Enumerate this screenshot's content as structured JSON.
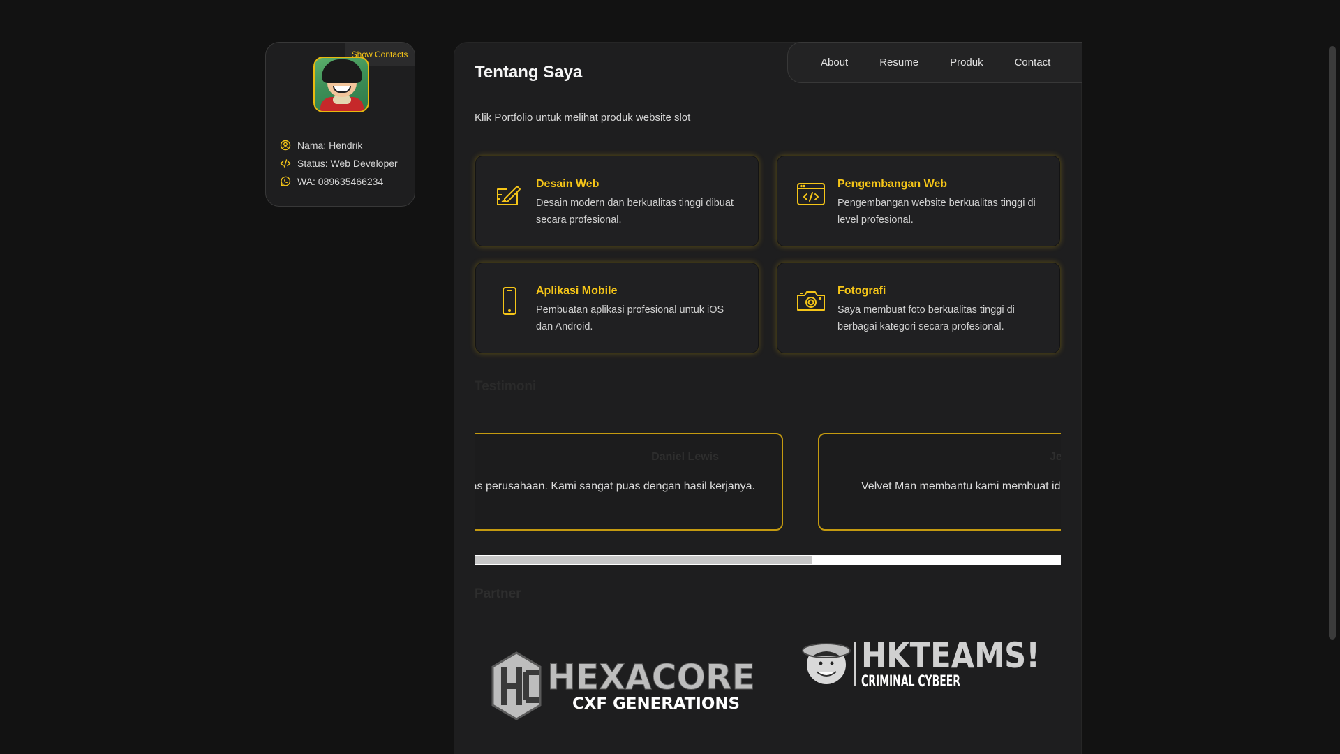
{
  "sidebar": {
    "show_contacts": "Show Contacts",
    "info": [
      {
        "icon": "user-circle-icon",
        "text": "Nama: Hendrik"
      },
      {
        "icon": "code-icon",
        "text": "Status: Web Developer"
      },
      {
        "icon": "whatsapp-icon",
        "text": "WA: 089635466234"
      }
    ]
  },
  "nav": {
    "items": [
      "About",
      "Resume",
      "Produk",
      "Contact"
    ]
  },
  "about": {
    "title": "Tentang Saya",
    "intro": "Klik Portfolio untuk melihat produk website slot"
  },
  "services": [
    {
      "icon": "design-pencil-icon",
      "title": "Desain Web",
      "desc": "Desain modern dan berkualitas tinggi dibuat secara profesional."
    },
    {
      "icon": "code-window-icon",
      "title": "Pengembangan Web",
      "desc": "Pengembangan website berkualitas tinggi di level profesional."
    },
    {
      "icon": "smartphone-icon",
      "title": "Aplikasi Mobile",
      "desc": "Pembuatan aplikasi profesional untuk iOS dan Android."
    },
    {
      "icon": "camera-icon",
      "title": "Fotografi",
      "desc": "Saya membuat foto berkualitas tinggi di berbagai kategori secara profesional."
    }
  ],
  "testimonials": {
    "title": "Testimoni",
    "items": [
      {
        "name": "Daniel Lewis",
        "text": "Velvet Man membantu kami membuat identitas perusahaan. Kami sangat puas dengan hasil kerjanya."
      },
      {
        "name": "Jessica Miller",
        "text": "Velvet Man membantu kami membuat identitas perusahaan. Kami sangat puas dengan hasil kerjanya."
      }
    ],
    "scroll_progress": 0.575
  },
  "partners": {
    "title": "Partner",
    "logos": [
      {
        "line1": "HEXACORE",
        "line2": "CXF GENERATIONS"
      },
      {
        "line1": "HKTEAMS!",
        "line2": "CRIMINAL CYBEER"
      }
    ]
  },
  "colors": {
    "accent": "#f5c518",
    "background": "#121212",
    "card": "#1e1e1f"
  }
}
